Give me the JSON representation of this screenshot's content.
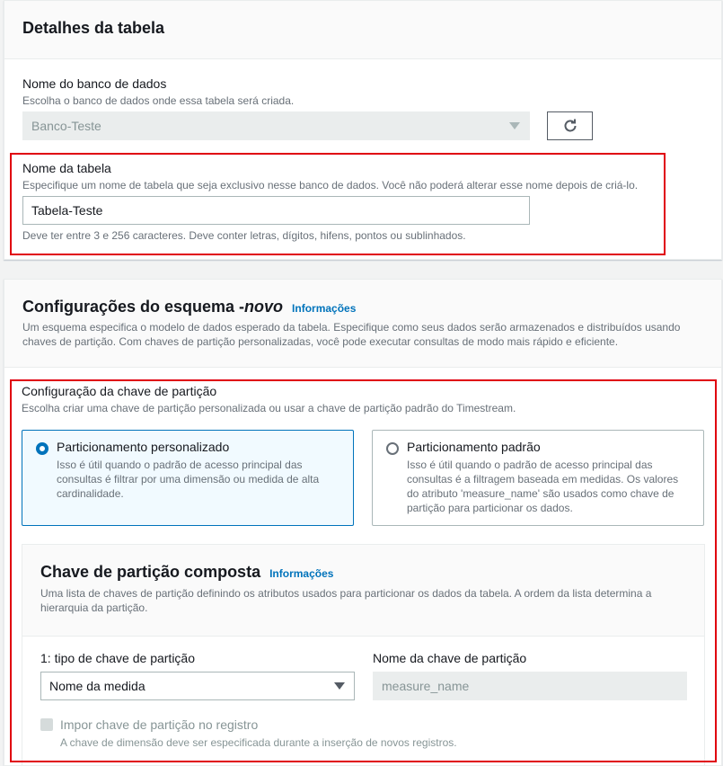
{
  "table_details": {
    "title": "Detalhes da tabela",
    "database": {
      "label": "Nome do banco de dados",
      "description": "Escolha o banco de dados onde essa tabela será criada.",
      "value": "Banco-Teste"
    },
    "table_name": {
      "label": "Nome da tabela",
      "description": "Especifique um nome de tabela que seja exclusivo nesse banco de dados. Você não poderá alterar esse nome depois de criá-lo.",
      "value": "Tabela-Teste",
      "constraint": "Deve ter entre 3 e 256 caracteres. Deve conter letras, dígitos, hifens, pontos ou sublinhados."
    }
  },
  "schema": {
    "title_prefix": "Configurações do esquema -",
    "title_new": "novo",
    "info_link": "Informações",
    "description": "Um esquema especifica o modelo de dados esperado da tabela. Especifique como seus dados serão armazenados e distribuídos usando chaves de partição. Com chaves de partição personalizadas, você pode executar consultas de modo mais rápido e eficiente.",
    "partition_config": {
      "label": "Configuração da chave de partição",
      "description": "Escolha criar uma chave de partição personalizada ou usar a chave de partição padrão do Timestream.",
      "options": [
        {
          "title": "Particionamento personalizado",
          "description": "Isso é útil quando o padrão de acesso principal das consultas é filtrar por uma dimensão ou medida de alta cardinalidade.",
          "selected": true
        },
        {
          "title": "Particionamento padrão",
          "description": "Isso é útil quando o padrão de acesso principal das consultas é a filtragem baseada em medidas. Os valores do atributo 'measure_name' são usados como chave de partição para particionar os dados.",
          "selected": false
        }
      ]
    },
    "composite_key": {
      "title": "Chave de partição composta",
      "info_link": "Informações",
      "description": "Uma lista de chaves de partição definindo os atributos usados para particionar os dados da tabela. A ordem da lista determina a hierarquia da partição.",
      "type_label": "1: tipo de chave de partição",
      "type_value": "Nome da medida",
      "name_label": "Nome da chave de partição",
      "name_value": "measure_name",
      "enforce_label": "Impor chave de partição no registro",
      "enforce_description": "A chave de dimensão deve ser especificada durante a inserção de novos registros."
    }
  },
  "colors": {
    "accent": "#0073bb",
    "highlight": "#e0000f"
  }
}
